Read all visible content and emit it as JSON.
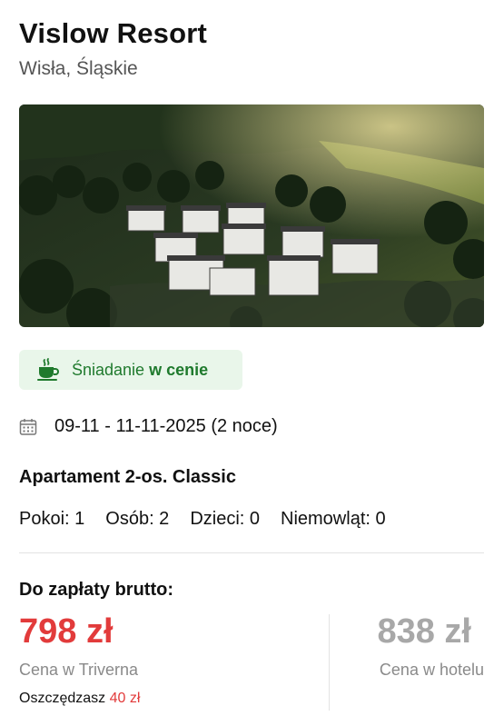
{
  "hotel": {
    "name": "Vislow Resort",
    "location": "Wisła, Śląskie",
    "photo_icon": "resort-aerial-photo"
  },
  "badge": {
    "icon": "coffee-cup-icon",
    "prefix": "Śniadanie",
    "emphasis": "w cenie",
    "color": "#1f7a2d",
    "background": "#e9f6ea"
  },
  "stay": {
    "icon": "calendar-icon",
    "dates": "09-11 - 11-11-2025 (2 noce)"
  },
  "room": {
    "name": "Apartament 2-os. Classic",
    "occupancy": [
      "Pokoi: 1",
      "Osób: 2",
      "Dzieci: 0",
      "Niemowląt: 0"
    ]
  },
  "payment": {
    "label": "Do zapłaty brutto:",
    "our_price": "798 zł",
    "our_price_caption": "Cena w Triverna",
    "savings_label": "Oszczędzasz",
    "savings_amount": "40 zł",
    "hotel_price": "838 zł",
    "hotel_price_caption": "Cena w hotelu",
    "accent_color": "#e23b3b"
  }
}
